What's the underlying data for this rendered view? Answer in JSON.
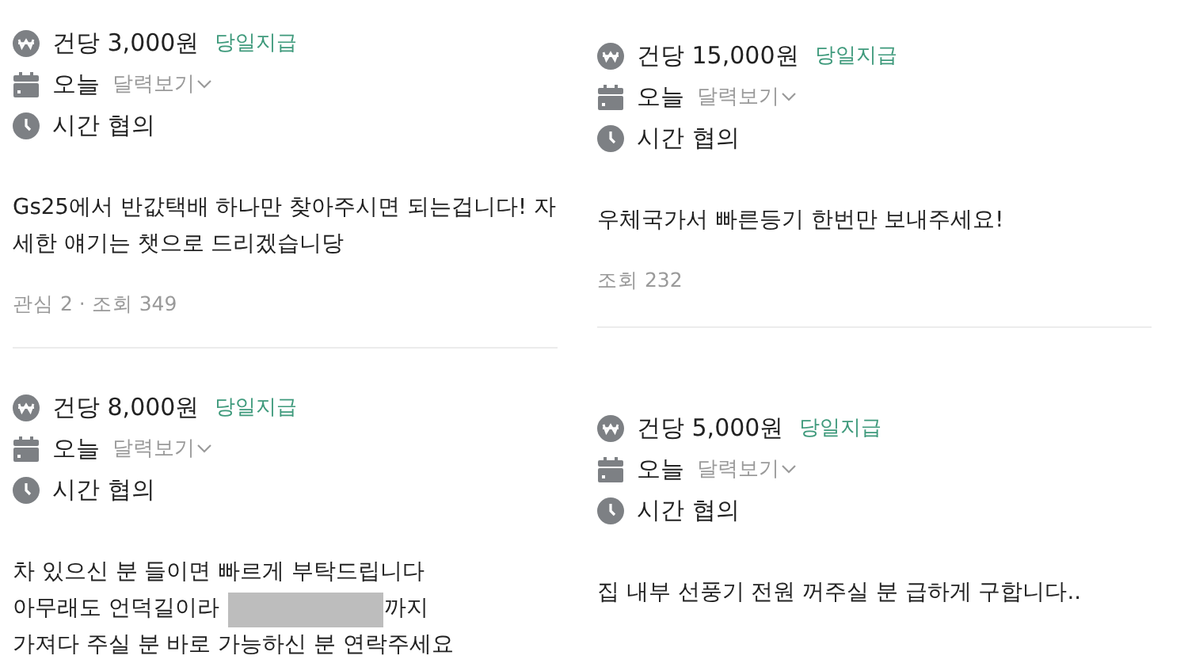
{
  "columns": [
    {
      "cards": [
        {
          "price": "건당 3,000원",
          "payout": "당일지급",
          "date": "오늘",
          "calendar_link": "달력보기",
          "time": "시간 협의",
          "lines": [
            {
              "text": "Gs25에서 반값택배 하나만 찾아주시면 되는겁니다! 자",
              "redacted": false
            },
            {
              "text": "세한 얘기는 챗으로 드리겠습니당",
              "redacted": false
            }
          ],
          "stats": "관심 2 · 조회 349"
        },
        {
          "price": "건당 8,000원",
          "payout": "당일지급",
          "date": "오늘",
          "calendar_link": "달력보기",
          "time": "시간 협의",
          "lines": [
            {
              "text": "차 있으신 분 들이면 빠르게 부탁드립니다",
              "redacted": false
            },
            {
              "text": "아무래도 언덕길이라",
              "redacted": true,
              "after": "까지"
            },
            {
              "text": "가져다 주실 분 바로 가능하신 분 연락주세요",
              "redacted": false
            }
          ]
        }
      ]
    },
    {
      "cards": [
        {
          "price": "건당 15,000원",
          "payout": "당일지급",
          "date": "오늘",
          "calendar_link": "달력보기",
          "time": "시간 협의",
          "lines": [
            {
              "text": "우체국가서 빠른등기 한번만 보내주세요!",
              "redacted": false
            }
          ],
          "stats": "조회 232"
        },
        {
          "price": "건당 5,000원",
          "payout": "당일지급",
          "date": "오늘",
          "calendar_link": "달력보기",
          "time": "시간 협의",
          "lines": [
            {
              "text": "집 내부 선풍기 전원 꺼주실 분 급하게 구합니다..",
              "redacted": false
            }
          ]
        }
      ]
    }
  ]
}
